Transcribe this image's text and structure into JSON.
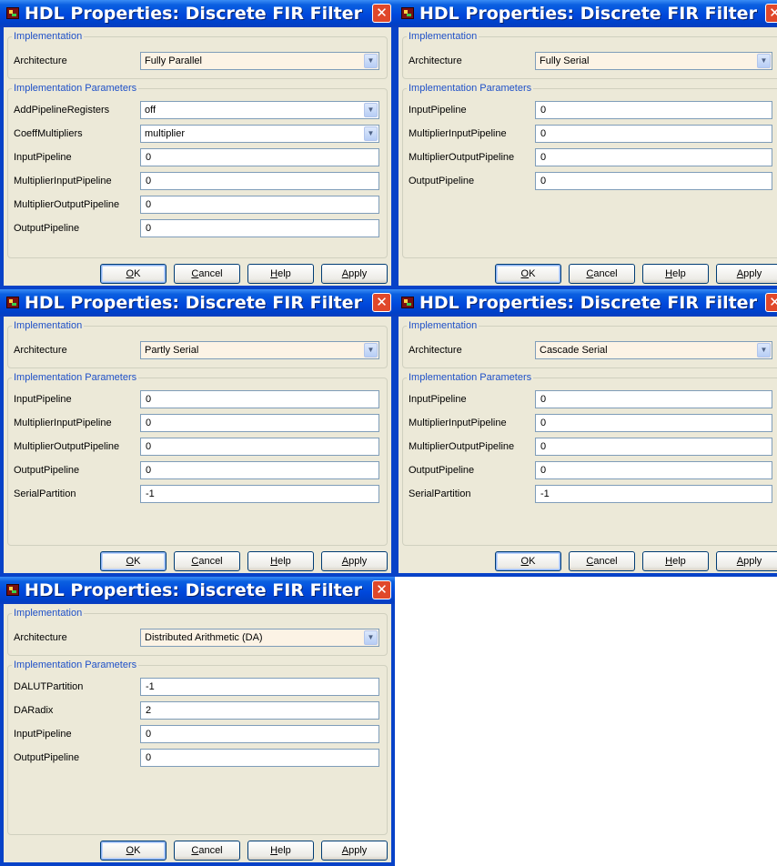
{
  "dialogs": [
    {
      "title": "HDL Properties: Discrete FIR Filter",
      "implementation_group": "Implementation",
      "architecture_label": "Architecture",
      "architecture_value": "Fully Parallel",
      "params_group": "Implementation Parameters",
      "params": [
        {
          "label": "AddPipelineRegisters",
          "value": "off",
          "kind": "select"
        },
        {
          "label": "CoeffMultipliers",
          "value": "multiplier",
          "kind": "select"
        },
        {
          "label": "InputPipeline",
          "value": "0",
          "kind": "text"
        },
        {
          "label": "MultiplierInputPipeline",
          "value": "0",
          "kind": "text"
        },
        {
          "label": "MultiplierOutputPipeline",
          "value": "0",
          "kind": "text"
        },
        {
          "label": "OutputPipeline",
          "value": "0",
          "kind": "text"
        }
      ],
      "buttons": {
        "ok": "OK",
        "cancel": "Cancel",
        "help": "Help",
        "apply": "Apply"
      }
    },
    {
      "title": "HDL Properties: Discrete FIR Filter",
      "implementation_group": "Implementation",
      "architecture_label": "Architecture",
      "architecture_value": "Fully Serial",
      "params_group": "Implementation Parameters",
      "params": [
        {
          "label": "InputPipeline",
          "value": "0",
          "kind": "text"
        },
        {
          "label": "MultiplierInputPipeline",
          "value": "0",
          "kind": "text"
        },
        {
          "label": "MultiplierOutputPipeline",
          "value": "0",
          "kind": "text"
        },
        {
          "label": "OutputPipeline",
          "value": "0",
          "kind": "text"
        }
      ],
      "buttons": {
        "ok": "OK",
        "cancel": "Cancel",
        "help": "Help",
        "apply": "Apply"
      }
    },
    {
      "title": "HDL Properties: Discrete FIR Filter",
      "implementation_group": "Implementation",
      "architecture_label": "Architecture",
      "architecture_value": "Partly Serial",
      "params_group": "Implementation Parameters",
      "params": [
        {
          "label": "InputPipeline",
          "value": "0",
          "kind": "text"
        },
        {
          "label": "MultiplierInputPipeline",
          "value": "0",
          "kind": "text"
        },
        {
          "label": "MultiplierOutputPipeline",
          "value": "0",
          "kind": "text"
        },
        {
          "label": "OutputPipeline",
          "value": "0",
          "kind": "text"
        },
        {
          "label": "SerialPartition",
          "value": "-1",
          "kind": "text"
        }
      ],
      "buttons": {
        "ok": "OK",
        "cancel": "Cancel",
        "help": "Help",
        "apply": "Apply"
      }
    },
    {
      "title": "HDL Properties: Discrete FIR Filter",
      "implementation_group": "Implementation",
      "architecture_label": "Architecture",
      "architecture_value": "Cascade Serial",
      "params_group": "Implementation Parameters",
      "params": [
        {
          "label": "InputPipeline",
          "value": "0",
          "kind": "text"
        },
        {
          "label": "MultiplierInputPipeline",
          "value": "0",
          "kind": "text"
        },
        {
          "label": "MultiplierOutputPipeline",
          "value": "0",
          "kind": "text"
        },
        {
          "label": "OutputPipeline",
          "value": "0",
          "kind": "text"
        },
        {
          "label": "SerialPartition",
          "value": "-1",
          "kind": "text"
        }
      ],
      "buttons": {
        "ok": "OK",
        "cancel": "Cancel",
        "help": "Help",
        "apply": "Apply"
      }
    },
    {
      "title": "HDL Properties: Discrete FIR Filter",
      "implementation_group": "Implementation",
      "architecture_label": "Architecture",
      "architecture_value": "Distributed Arithmetic (DA)",
      "params_group": "Implementation Parameters",
      "params": [
        {
          "label": "DALUTPartition",
          "value": "-1",
          "kind": "text"
        },
        {
          "label": "DARadix",
          "value": "2",
          "kind": "text"
        },
        {
          "label": "InputPipeline",
          "value": "0",
          "kind": "text"
        },
        {
          "label": "OutputPipeline",
          "value": "0",
          "kind": "text"
        }
      ],
      "buttons": {
        "ok": "OK",
        "cancel": "Cancel",
        "help": "Help",
        "apply": "Apply"
      }
    }
  ]
}
